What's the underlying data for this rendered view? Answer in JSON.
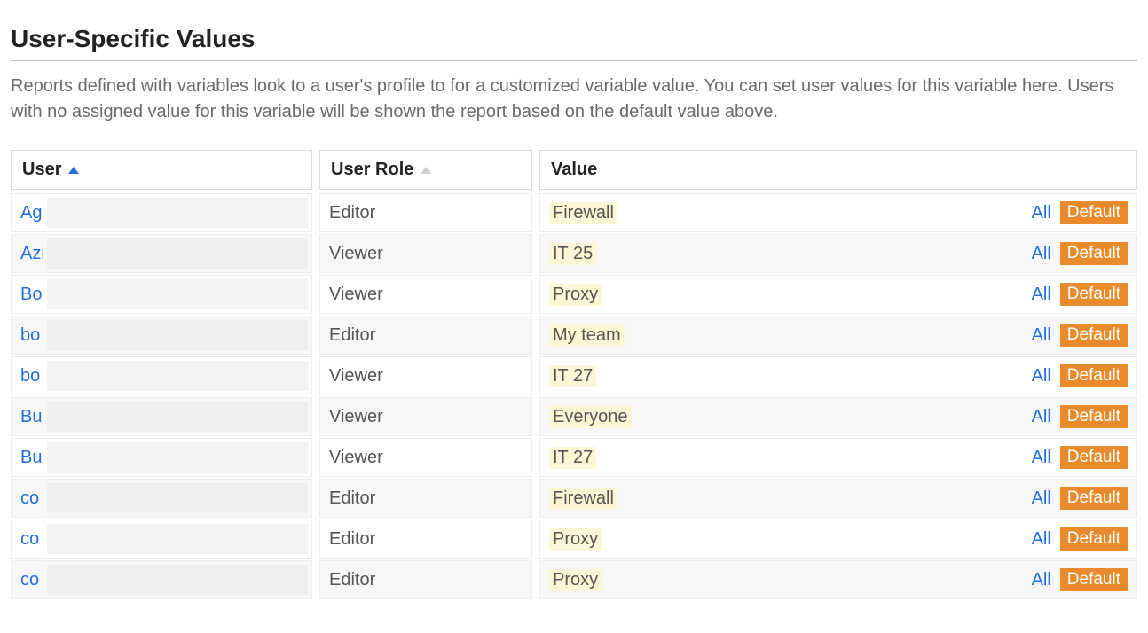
{
  "section": {
    "title": "User-Specific Values",
    "description": "Reports defined with variables look to a user's profile to for a customized variable value. You can set user values for this variable here. Users with no assigned value for this variable will be shown the report based on the default value above."
  },
  "table": {
    "headers": {
      "user": "User",
      "user_role": "User Role",
      "value": "Value"
    },
    "actions": {
      "all_label": "All",
      "default_label": "Default"
    },
    "rows": [
      {
        "user_prefix": "Ag",
        "role": "Editor",
        "value": "Firewall"
      },
      {
        "user_prefix": "Azi",
        "role": "Viewer",
        "value": "IT 25"
      },
      {
        "user_prefix": "Bo",
        "role": "Viewer",
        "value": "Proxy"
      },
      {
        "user_prefix": "bo",
        "role": "Editor",
        "value": "My team"
      },
      {
        "user_prefix": "bo",
        "role": "Viewer",
        "value": "IT 27"
      },
      {
        "user_prefix": "Bu",
        "role": "Viewer",
        "value": "Everyone"
      },
      {
        "user_prefix": "Bu",
        "role": "Viewer",
        "value": "IT 27"
      },
      {
        "user_prefix": "co",
        "role": "Editor",
        "value": "Firewall"
      },
      {
        "user_prefix": "co",
        "role": "Editor",
        "value": "Proxy"
      },
      {
        "user_prefix": "co",
        "role": "Editor",
        "value": "Proxy"
      }
    ]
  }
}
